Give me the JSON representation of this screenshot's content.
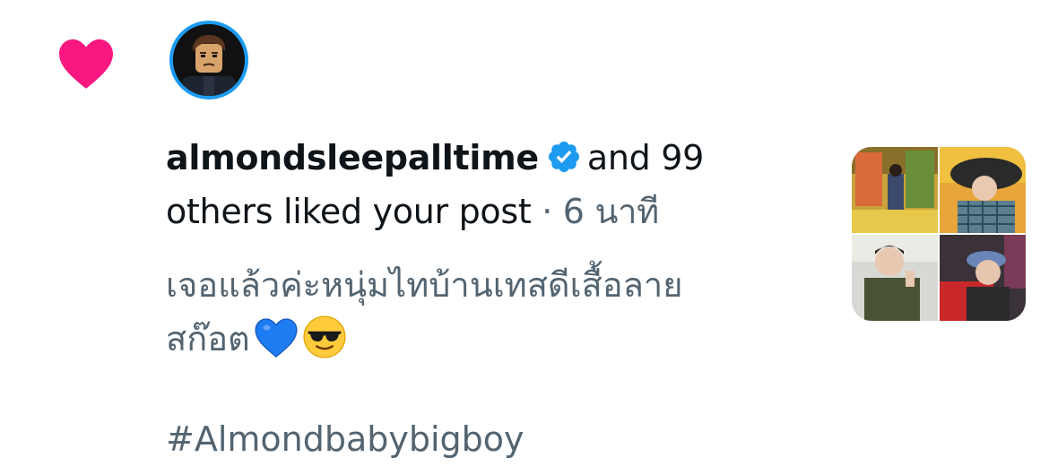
{
  "notification": {
    "type_icon": "heart-icon",
    "avatar_icon": "lego-minifigure-avatar",
    "username": "almondsleepalltime",
    "verified_icon": "verified-badge-icon",
    "action_part1": "and 99",
    "action_part2": "others liked your post",
    "separator": "·",
    "time_ago": "6 นาที",
    "post_text_line1": "เจอแล้วค่ะหนุ่มไทบ้านเทสดีเสื้อลาย",
    "post_text_line2": "สก๊อต",
    "emoji_1": "blue-heart-emoji",
    "emoji_2": "sunglasses-emoji",
    "hashtag": "#Almondbabybigboy",
    "thumbnail": "photo-collage-thumbnail"
  },
  "colors": {
    "like_heart": "#f91880",
    "verified_blue": "#1d9bf0",
    "primary_text": "#0f1419",
    "secondary_text": "#536471"
  }
}
